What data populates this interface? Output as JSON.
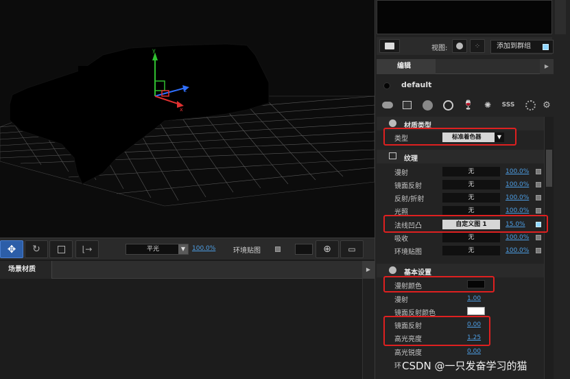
{
  "toolbar": {
    "light_mode": "平光",
    "light_percent": "100.0%",
    "env_map_label": "环境贴图"
  },
  "scene_panel": {
    "tab_label": "场景材质"
  },
  "right_panel": {
    "view_label": "视图:",
    "add_to_group": "添加到群组",
    "edit_tab": "编辑",
    "material_name": "default",
    "sections": {
      "material_type": {
        "title": "材质类型",
        "type_label": "类型",
        "type_value": "标准着色器"
      },
      "texture": {
        "title": "纹理",
        "rows": [
          {
            "label": "漫射",
            "value": "无",
            "percent": "100.0%"
          },
          {
            "label": "镜面反射",
            "value": "无",
            "percent": "100.0%"
          },
          {
            "label": "反射/折射",
            "value": "无",
            "percent": "100.0%"
          },
          {
            "label": "光照",
            "value": "无",
            "percent": "100.0%"
          },
          {
            "label": "法线凹凸",
            "value": "自定义图 1",
            "percent": "15.0%"
          },
          {
            "label": "吸收",
            "value": "无",
            "percent": "100.0%"
          },
          {
            "label": "环境贴图",
            "value": "无",
            "percent": "100.0%"
          }
        ]
      },
      "basic": {
        "title": "基本设置",
        "diffuse_color_label": "漫射颜色",
        "diffuse_label": "漫射",
        "diffuse_value": "1.00",
        "specular_color_label": "镜面反射颜色",
        "specular_label": "镜面反射",
        "specular_value": "0.00",
        "highlight_brightness_label": "高光亮度",
        "highlight_brightness_value": "1.25",
        "highlight_sharpness_label": "高光锐度",
        "highlight_sharpness_value": "0.00",
        "env_label": "环"
      }
    }
  },
  "colors": {
    "accent_blue": "#4d9fe6",
    "highlight_red": "#e02020",
    "diffuse_color": "#050505",
    "specular_color": "#ffffff"
  },
  "watermark": "CSDN @一只发奋学习的猫"
}
